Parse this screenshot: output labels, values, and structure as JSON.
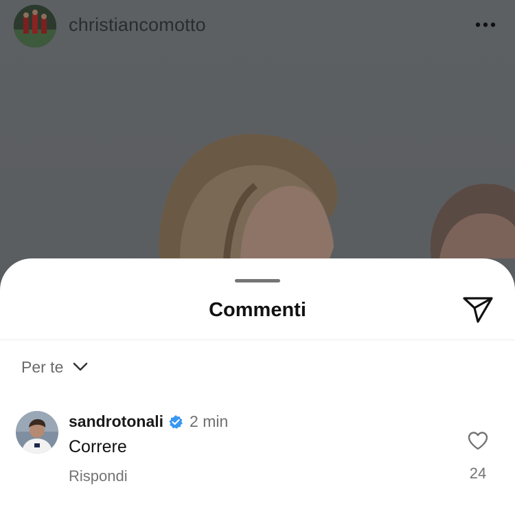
{
  "post": {
    "username": "christiancomotto",
    "avatar_icon": "profile-avatar-icon",
    "more_icon": "more-horizontal-icon"
  },
  "sheet": {
    "title": "Commenti",
    "share_icon": "send-icon",
    "sort": {
      "label": "Per te",
      "icon": "chevron-down-icon"
    }
  },
  "comments": [
    {
      "username": "sandrotonali",
      "verified": true,
      "verified_color": "#3897f0",
      "time": "2 min",
      "text": "Correre",
      "reply_label": "Rispondi",
      "likes": "24"
    }
  ],
  "colors": {
    "overlay": "#5c5f62",
    "sheet_bg": "#ffffff",
    "secondary_text": "#737373",
    "verified_blue": "#3897f0"
  }
}
